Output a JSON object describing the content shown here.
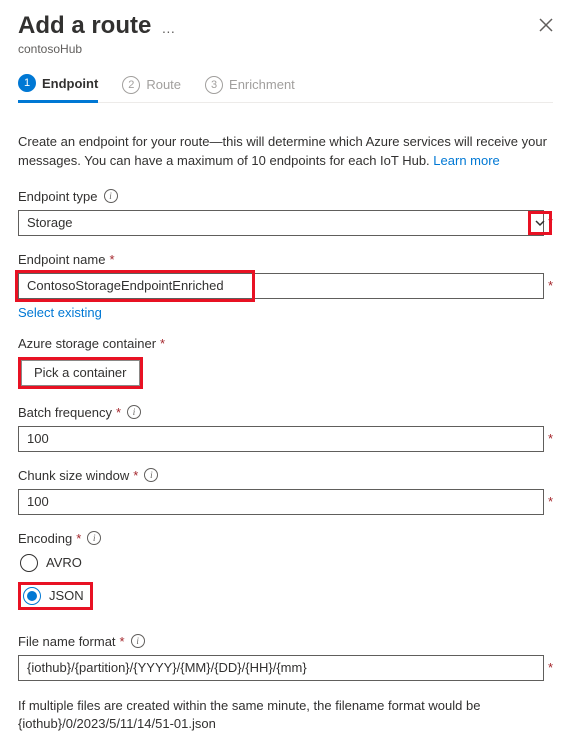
{
  "header": {
    "title": "Add a route",
    "sub": "contosoHub"
  },
  "steps": [
    {
      "num": "1",
      "label": "Endpoint",
      "active": true
    },
    {
      "num": "2",
      "label": "Route",
      "active": false
    },
    {
      "num": "3",
      "label": "Enrichment",
      "active": false
    }
  ],
  "intro": {
    "text": "Create an endpoint for your route—this will determine which Azure services will receive your messages. You can have a maximum of 10 endpoints for each IoT Hub. ",
    "learnMore": "Learn more"
  },
  "endpointType": {
    "label": "Endpoint type",
    "value": "Storage"
  },
  "endpointName": {
    "label": "Endpoint name",
    "value": "ContosoStorageEndpointEnriched",
    "selectExisting": "Select existing"
  },
  "storageContainer": {
    "label": "Azure storage container",
    "button": "Pick a container"
  },
  "batchFrequency": {
    "label": "Batch frequency",
    "value": "100"
  },
  "chunkSize": {
    "label": "Chunk size window",
    "value": "100"
  },
  "encoding": {
    "label": "Encoding",
    "options": [
      {
        "label": "AVRO",
        "checked": false
      },
      {
        "label": "JSON",
        "checked": true
      }
    ]
  },
  "fileNameFormat": {
    "label": "File name format",
    "value": "{iothub}/{partition}/{YYYY}/{MM}/{DD}/{HH}/{mm}"
  },
  "footnote": "If multiple files are created within the same minute, the filename format would be {iothub}/0/2023/5/11/14/51-01.json"
}
